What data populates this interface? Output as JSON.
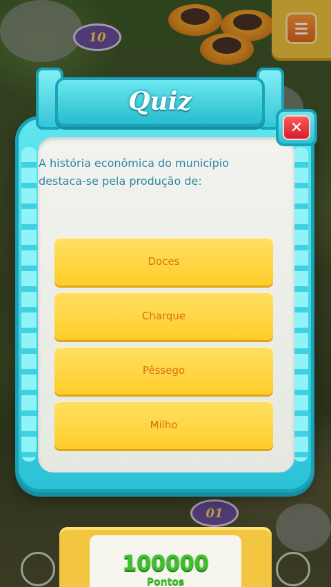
{
  "map": {
    "level_nodes": [
      "10",
      "01"
    ]
  },
  "menu": {
    "icon": "menu-icon"
  },
  "quiz": {
    "title": "Quiz",
    "close_icon": "close-icon",
    "close_glyph": "✕",
    "question": "A história econômica do município destaca-se pela produção de:",
    "answers": [
      "Doces",
      "Charque",
      "Pêssego",
      "Milho"
    ]
  },
  "score": {
    "value": "100000",
    "label": "Pontos"
  },
  "colors": {
    "frame": "#2cc2d6",
    "answer": "#ffcd2a",
    "answer_text": "#d8700e",
    "question_text": "#2c86a4",
    "close": "#d21f2c",
    "score": "#3dbf2a"
  }
}
